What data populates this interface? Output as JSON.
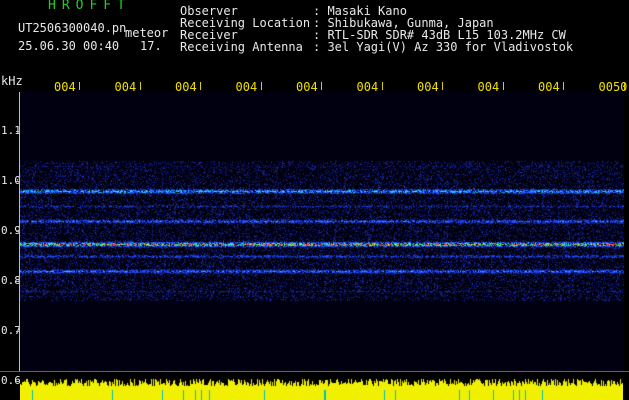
{
  "header": {
    "program_title": "HROFFT",
    "filename": "UT2506300040.pn",
    "mode": "meteor",
    "datetime": "25.06.30 00:40",
    "value": "17.",
    "info_labels": [
      "Observer",
      "Receiving Location",
      "Receiver",
      "Receiving Antenna"
    ],
    "info_values": [
      ": Masaki Kano",
      ": Shibukawa, Gunma, Japan",
      ": RTL-SDR SDR# 43dB L15 103.2MHz CW",
      ": 3el Yagi(V) Az 330 for Vladivostok"
    ]
  },
  "axis": {
    "unit": "kHz",
    "y_ticks": [
      "1.1",
      "1.0",
      "0.9",
      "0.8",
      "0.7",
      "0.6"
    ],
    "x_ticks": [
      "004",
      "004",
      "004",
      "004",
      "004",
      "004",
      "004",
      "004",
      "004",
      "0050"
    ]
  },
  "colors": {
    "background": "#000000",
    "axis": "#d8d000",
    "text": "#e8e8e8",
    "title": "#20d020",
    "amplitude": "#f0f000"
  },
  "chart_data": {
    "type": "heatmap",
    "ylabel": "kHz",
    "ylim": [
      0.6,
      1.15
    ],
    "x_tick_labels": [
      "004",
      "004",
      "004",
      "004",
      "004",
      "004",
      "004",
      "004",
      "004",
      "0050"
    ],
    "bands_khz": [
      {
        "freq": 1.03,
        "intensity": 0.25
      },
      {
        "freq": 0.98,
        "intensity": 0.75
      },
      {
        "freq": 0.95,
        "intensity": 0.35
      },
      {
        "freq": 0.92,
        "intensity": 0.55
      },
      {
        "freq": 0.875,
        "intensity": 1.0
      },
      {
        "freq": 0.85,
        "intensity": 0.45
      },
      {
        "freq": 0.82,
        "intensity": 0.6
      },
      {
        "freq": 0.78,
        "intensity": 0.3
      }
    ],
    "noise_range_khz": [
      0.76,
      1.04
    ]
  }
}
